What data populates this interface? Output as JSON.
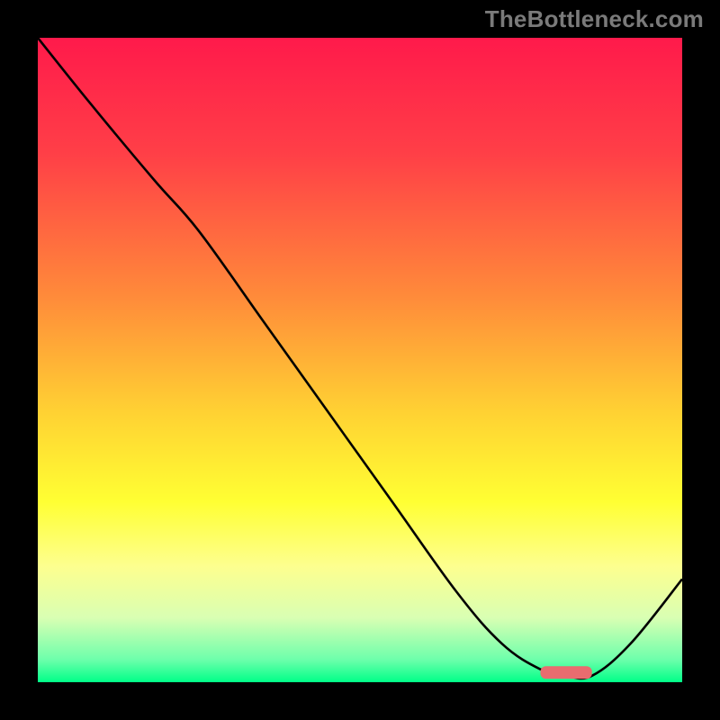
{
  "watermark": "TheBottleneck.com",
  "colors": {
    "frame": "#000000",
    "line": "#000000",
    "marker": "#e86c6f",
    "gradient_stops": [
      {
        "offset": 0.0,
        "color": "#ff1a4b"
      },
      {
        "offset": 0.18,
        "color": "#ff3f47"
      },
      {
        "offset": 0.4,
        "color": "#ff8a3a"
      },
      {
        "offset": 0.58,
        "color": "#ffd133"
      },
      {
        "offset": 0.72,
        "color": "#ffff33"
      },
      {
        "offset": 0.82,
        "color": "#fdff8f"
      },
      {
        "offset": 0.9,
        "color": "#d9ffb3"
      },
      {
        "offset": 0.965,
        "color": "#6dffab"
      },
      {
        "offset": 1.0,
        "color": "#00ff88"
      }
    ]
  },
  "chart_data": {
    "type": "line",
    "title": "",
    "xlabel": "",
    "ylabel": "",
    "xlim": [
      0,
      100
    ],
    "ylim": [
      0,
      100
    ],
    "series": [
      {
        "name": "curve",
        "x": [
          0,
          8,
          18,
          25,
          35,
          45,
          55,
          65,
          72,
          78,
          82,
          86,
          92,
          100
        ],
        "y": [
          100,
          90,
          78,
          70,
          56,
          42,
          28,
          14,
          6,
          2,
          1,
          1,
          6,
          16
        ]
      }
    ],
    "highlight_segment": {
      "x_start": 78,
      "x_end": 86,
      "y": 1.5
    }
  }
}
